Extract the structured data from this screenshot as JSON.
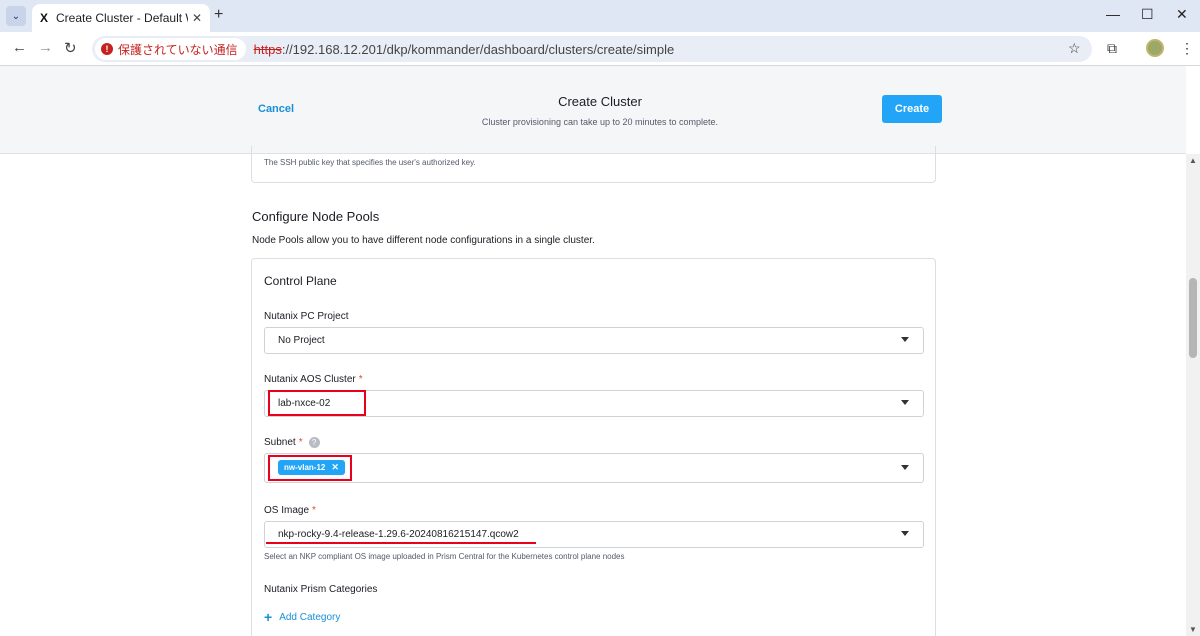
{
  "browser": {
    "tab_title": "Create Cluster - Default Worksp",
    "tab_favicon": "X",
    "security_chip": "保護されていない通信",
    "url_scheme": "https",
    "url_rest": "://192.168.12.201/dkp/kommander/dashboard/clusters/create/simple"
  },
  "header": {
    "cancel_label": "Cancel",
    "title": "Create Cluster",
    "subtitle": "Cluster provisioning can take up to 20 minutes to complete.",
    "create_label": "Create"
  },
  "ssh": {
    "help": "The SSH public key that specifies the user's authorized key."
  },
  "node_pools": {
    "title": "Configure Node Pools",
    "description": "Node Pools allow you to have different node configurations in a single cluster.",
    "control_plane": {
      "title": "Control Plane",
      "pc_project_label": "Nutanix PC Project",
      "pc_project_value": "No Project",
      "aos_cluster_label": "Nutanix AOS Cluster",
      "aos_cluster_value": "lab-nxce-02",
      "subnet_label": "Subnet",
      "subnet_tag": "nw-vlan-12",
      "os_image_label": "OS Image",
      "os_image_value": "nkp-rocky-9.4-release-1.29.6-20240816215147.qcow2",
      "os_image_help": "Select an NKP compliant OS image uploaded in Prism Central for the Kubernetes control plane nodes",
      "categories_label": "Nutanix Prism Categories",
      "add_category_label": "Add Category",
      "required_mark": "*"
    }
  },
  "colors": {
    "accent": "#22a5f7",
    "link": "#1890d6",
    "annotation_red": "#e8001c"
  }
}
